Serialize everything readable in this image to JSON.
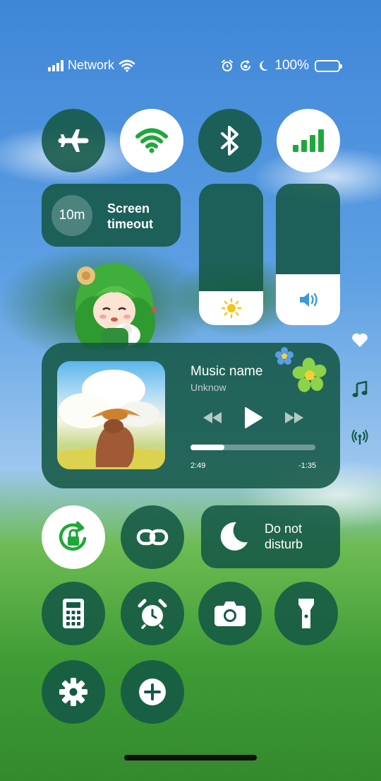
{
  "status_bar": {
    "network": "Network",
    "battery": "100%"
  },
  "toggles": {
    "airplane": {
      "icon": "airplane-icon",
      "active": false
    },
    "wifi": {
      "icon": "wifi-icon",
      "active": true
    },
    "bluetooth": {
      "icon": "bluetooth-icon",
      "active": false
    },
    "cellular": {
      "icon": "cellular-signal-icon",
      "active": true
    }
  },
  "screen_timeout": {
    "value": "10m",
    "label_line1": "Screen",
    "label_line2": "timeout"
  },
  "brightness": {
    "icon": "sun-icon",
    "level": 0.24
  },
  "volume": {
    "icon": "speaker-icon",
    "level": 0.36
  },
  "media": {
    "song": "Music name",
    "artist": "Unknow",
    "elapsed": "2:49",
    "remaining": "-1:35",
    "progress": 0.27
  },
  "do_not_disturb": {
    "label_line1": "Do not",
    "label_line2": "disturb"
  },
  "side_icons": [
    "heart-icon",
    "music-note-icon",
    "broadcast-icon"
  ],
  "colors": {
    "tile": "#145846",
    "accent_green": "#1fa83a",
    "active_tile": "#ffffff"
  }
}
